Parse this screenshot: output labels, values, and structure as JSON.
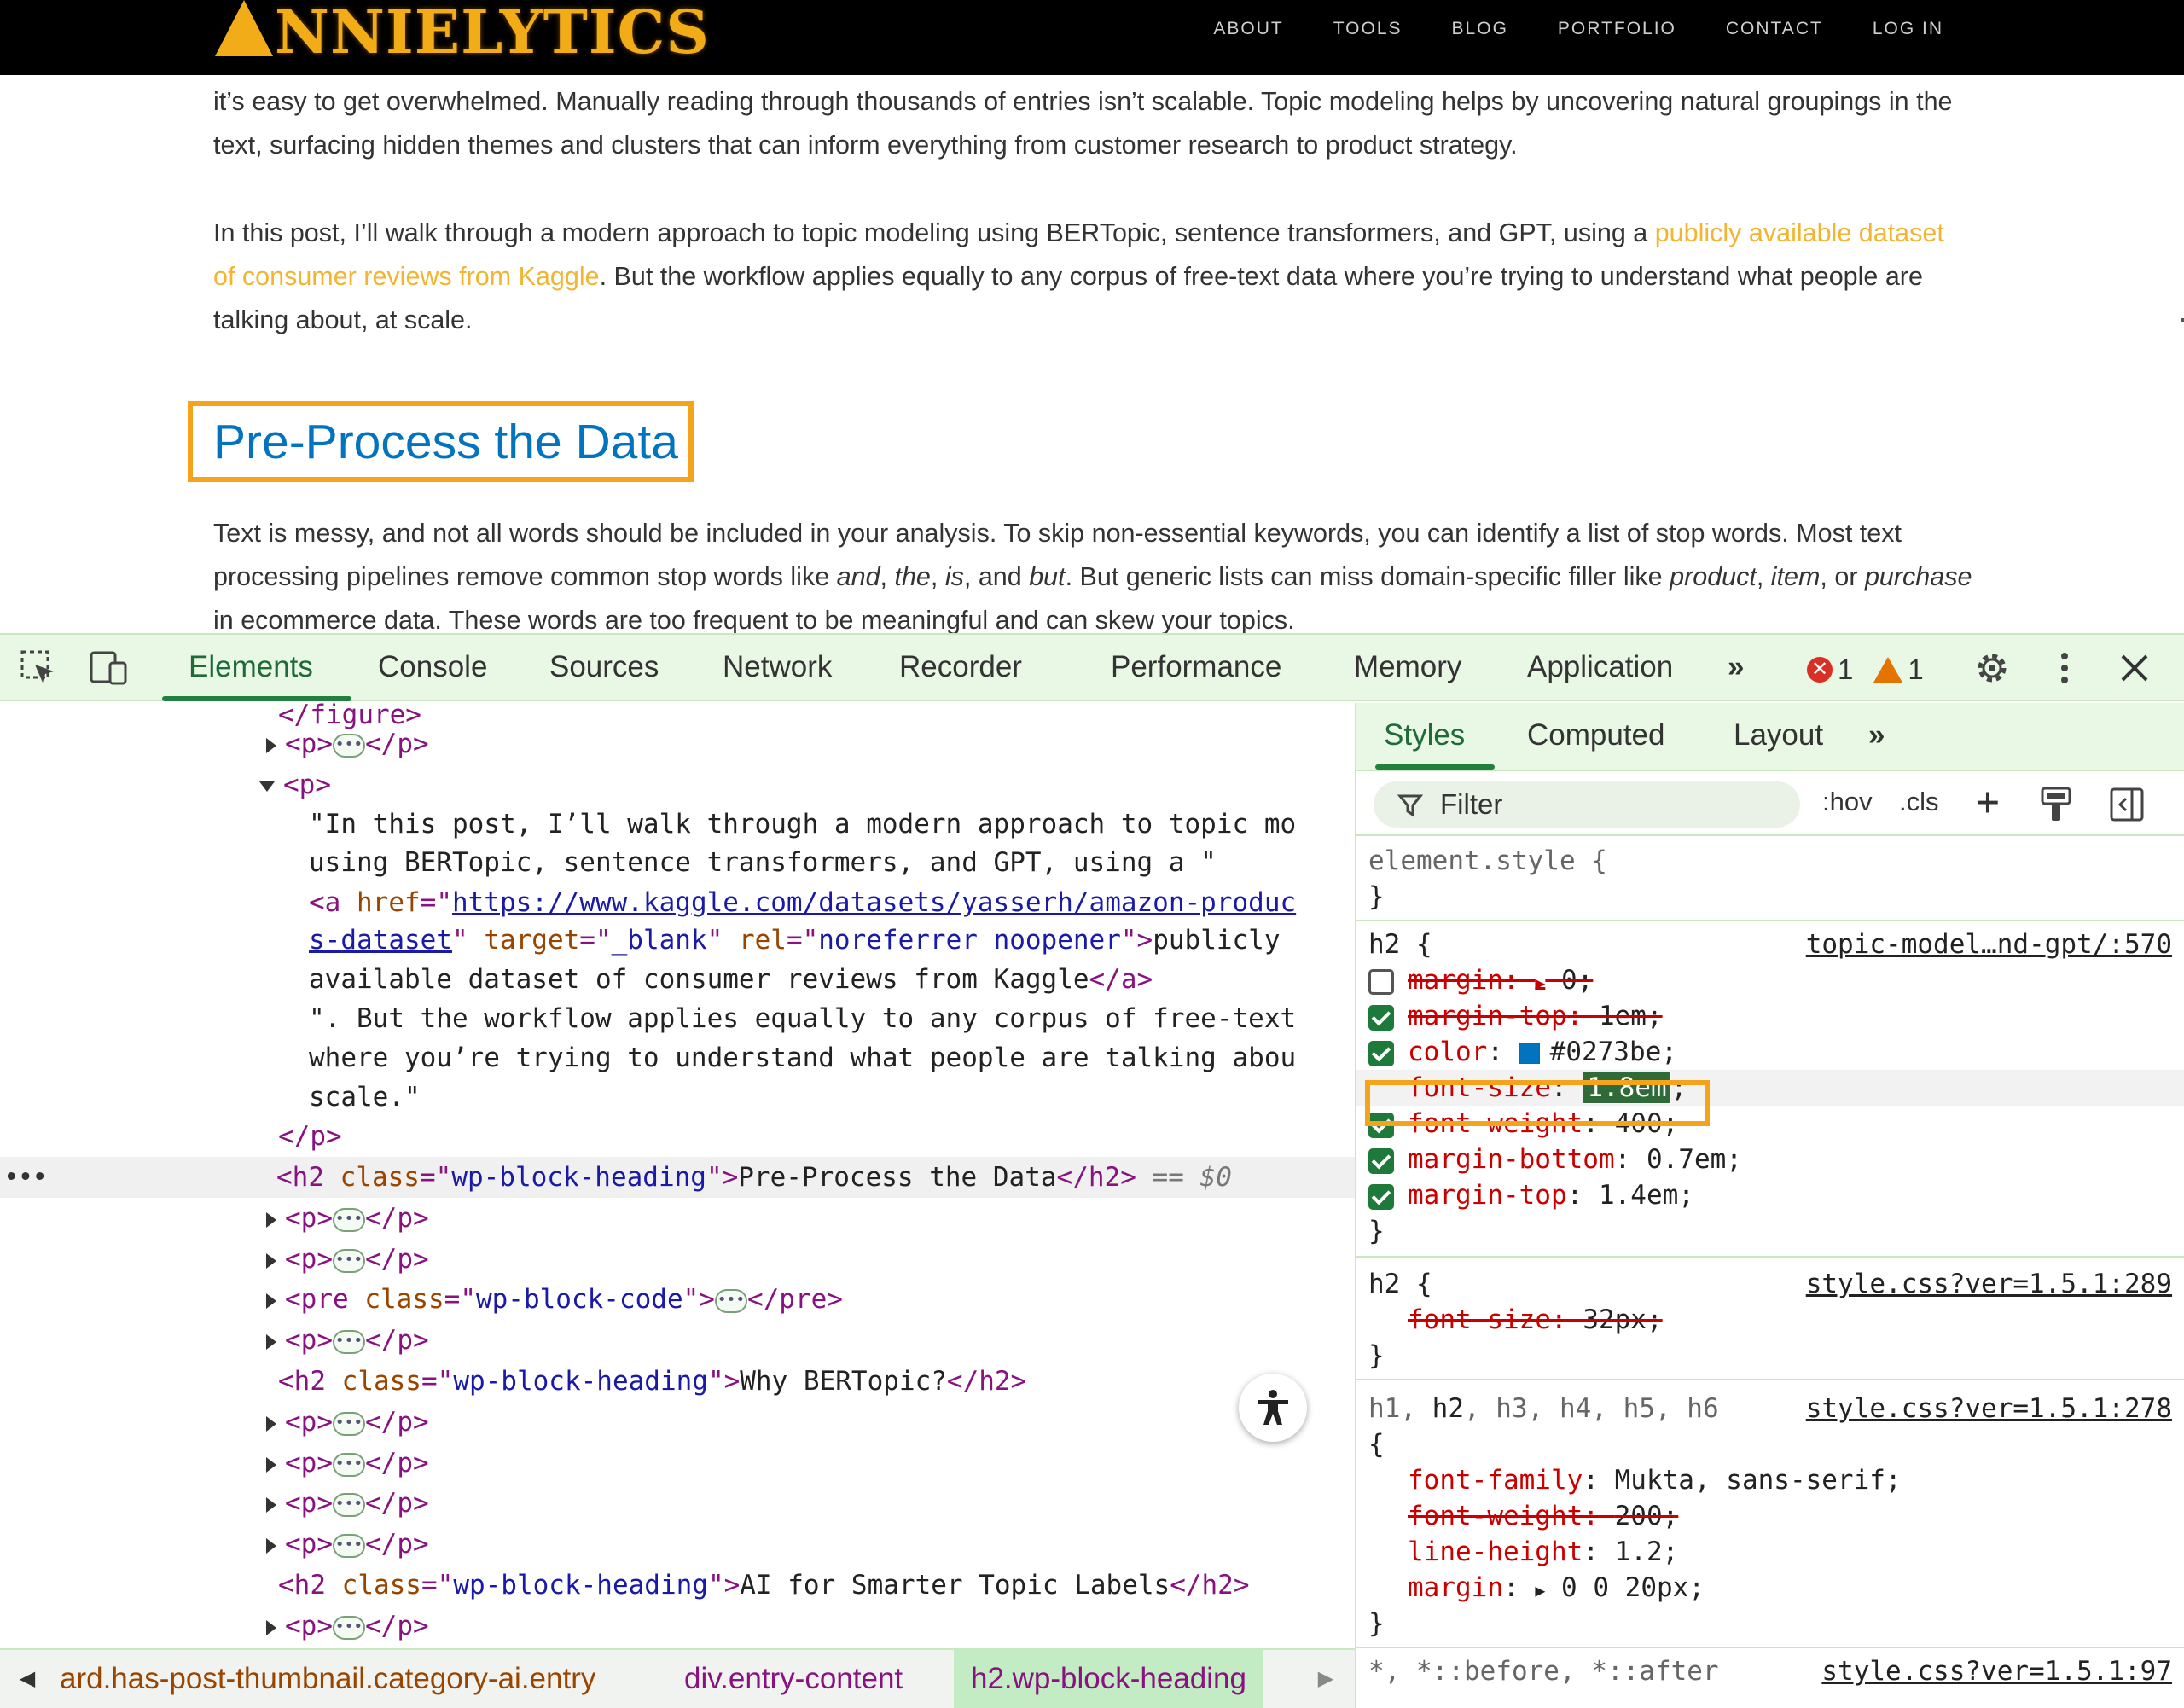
{
  "site": {
    "logo": "NNIELYTICS",
    "nav": [
      "ABOUT",
      "TOOLS",
      "BLOG",
      "PORTFOLIO",
      "CONTACT",
      "LOG IN"
    ]
  },
  "article": {
    "p1": "it’s easy to get overwhelmed. Manually reading through thousands of entries isn’t scalable. Topic modeling helps by uncovering natural groupings in the text, surfacing hidden themes and clusters that can inform everything from customer research to product strategy.",
    "p2_before": "In this post, I’ll walk through a modern approach to topic modeling using BERTopic, sentence transformers, and GPT, using a ",
    "p2_link": "publicly available dataset of consumer reviews from Kaggle",
    "p2_after": ". But the workflow applies equally to any corpus of free-text data where you’re trying to understand what people are talking about, at scale.",
    "heading": "Pre-Process the Data",
    "p3_a": "Text is messy, and not all words should be included in your analysis. To skip non-essential keywords, you can identify a list of stop words. Most text processing pipelines remove common stop words like ",
    "p3_and": "and",
    "p3_the": "the",
    "p3_is": "is",
    "p3_but": "but",
    "p3_b": ". But generic lists can miss domain-specific filler like ",
    "p3_product": "product",
    "p3_item": "item",
    "p3_or": ", or ",
    "p3_purchase": "purchase",
    "p3_c": " in ecommerce data. These words are too frequent to be meaningful and can skew your topics."
  },
  "devtools": {
    "tabs": [
      "Elements",
      "Console",
      "Sources",
      "Network",
      "Recorder",
      "Performance",
      "Memory",
      "Application"
    ],
    "error_count": "1",
    "warning_count": "1",
    "dom": {
      "figure_close": "</figure>",
      "p_open": "<p>",
      "p_close": "</p>",
      "text1": "\"In this post, I’ll walk through a modern approach to topic mo",
      "text2": "using BERTopic, sentence transformers, and GPT, using a \"",
      "a_open": "<a ",
      "href_attr": "href",
      "href_val": "https://www.kaggle.com/datasets/yasserh/amazon-produc",
      "href_val2": "s-dataset",
      "target_attr": "target",
      "target_val": "_blank",
      "rel_attr": "rel",
      "rel_val": "noreferrer noopener",
      "link_text1": "publicly",
      "link_text2": "available dataset of consumer reviews from Kaggle",
      "a_close": "</a>",
      "text3": "\". But the workflow applies equally to any corpus of free-text",
      "text4": "where you’re trying to understand what people are talking abou",
      "text5": "scale.\"",
      "h2_open": "<h2 ",
      "class_attr": "class",
      "h2_class": "wp-block-heading",
      "h2_text": "Pre-Process the Data",
      "h2_close": "</h2>",
      "sel_marker": "== $0",
      "pre_open": "<pre ",
      "pre_class": "wp-block-code",
      "pre_close": "</pre>",
      "h2b_text": "Why BERTopic?",
      "h2c_text": "AI for Smarter Topic Labels"
    },
    "styles": {
      "tabs": [
        "Styles",
        "Computed",
        "Layout"
      ],
      "filter_placeholder": "Filter",
      "hov": ":hov",
      "cls": ".cls",
      "element_style": "element.style {",
      "close_brace": "}",
      "rule1_selector": "h2 {",
      "rule1_source": "topic-model…nd-gpt/:570",
      "rule1": [
        {
          "prop": "margin",
          "value": "0;",
          "checked": false,
          "struck": true,
          "expand": true
        },
        {
          "prop": "margin-top",
          "value": "1em;",
          "checked": true,
          "struck": true
        },
        {
          "prop": "color",
          "value": "#0273be;",
          "checked": true,
          "struck": false,
          "swatch": "#0273be"
        },
        {
          "prop": "font-size",
          "value": "1.8em",
          "checked": false,
          "struck": false,
          "editing": true
        },
        {
          "prop": "font-weight",
          "value": "400;",
          "checked": true,
          "struck": false
        },
        {
          "prop": "margin-bottom",
          "value": "0.7em;",
          "checked": true,
          "struck": false
        },
        {
          "prop": "margin-top",
          "value": "1.4em;",
          "checked": true,
          "struck": false
        }
      ],
      "rule2_selector": "h2 {",
      "rule2_source": "style.css?ver=1.5.1:289",
      "rule2_prop": "font-size",
      "rule2_value": "32px;",
      "rule3_selector_a": "h1, ",
      "rule3_selector_b": "h2",
      "rule3_selector_c": ", h3, h4, h5, h6",
      "rule3_brace": "{",
      "rule3_source": "style.css?ver=1.5.1:278",
      "rule3": [
        {
          "prop": "font-family",
          "value": "Mukta, sans-serif;",
          "struck": false
        },
        {
          "prop": "font-weight",
          "value": "200;",
          "struck": true
        },
        {
          "prop": "line-height",
          "value": "1.2;",
          "struck": false
        },
        {
          "prop": "margin",
          "value": "0 0 20px;",
          "struck": false,
          "expand": true
        }
      ],
      "rule4_selector": "*, *::before, *::after",
      "rule4_source": "style.css?ver=1.5.1:97"
    },
    "breadcrumbs": [
      "ard.has-post-thumbnail.category-ai.entry",
      "div.entry-content",
      "h2.wp-block-heading"
    ]
  },
  "colors": {
    "accent_green": "#1e6a38",
    "highlight_orange": "#f5a31a",
    "heading_blue": "#0273be",
    "link_gold": "#f3b531"
  }
}
